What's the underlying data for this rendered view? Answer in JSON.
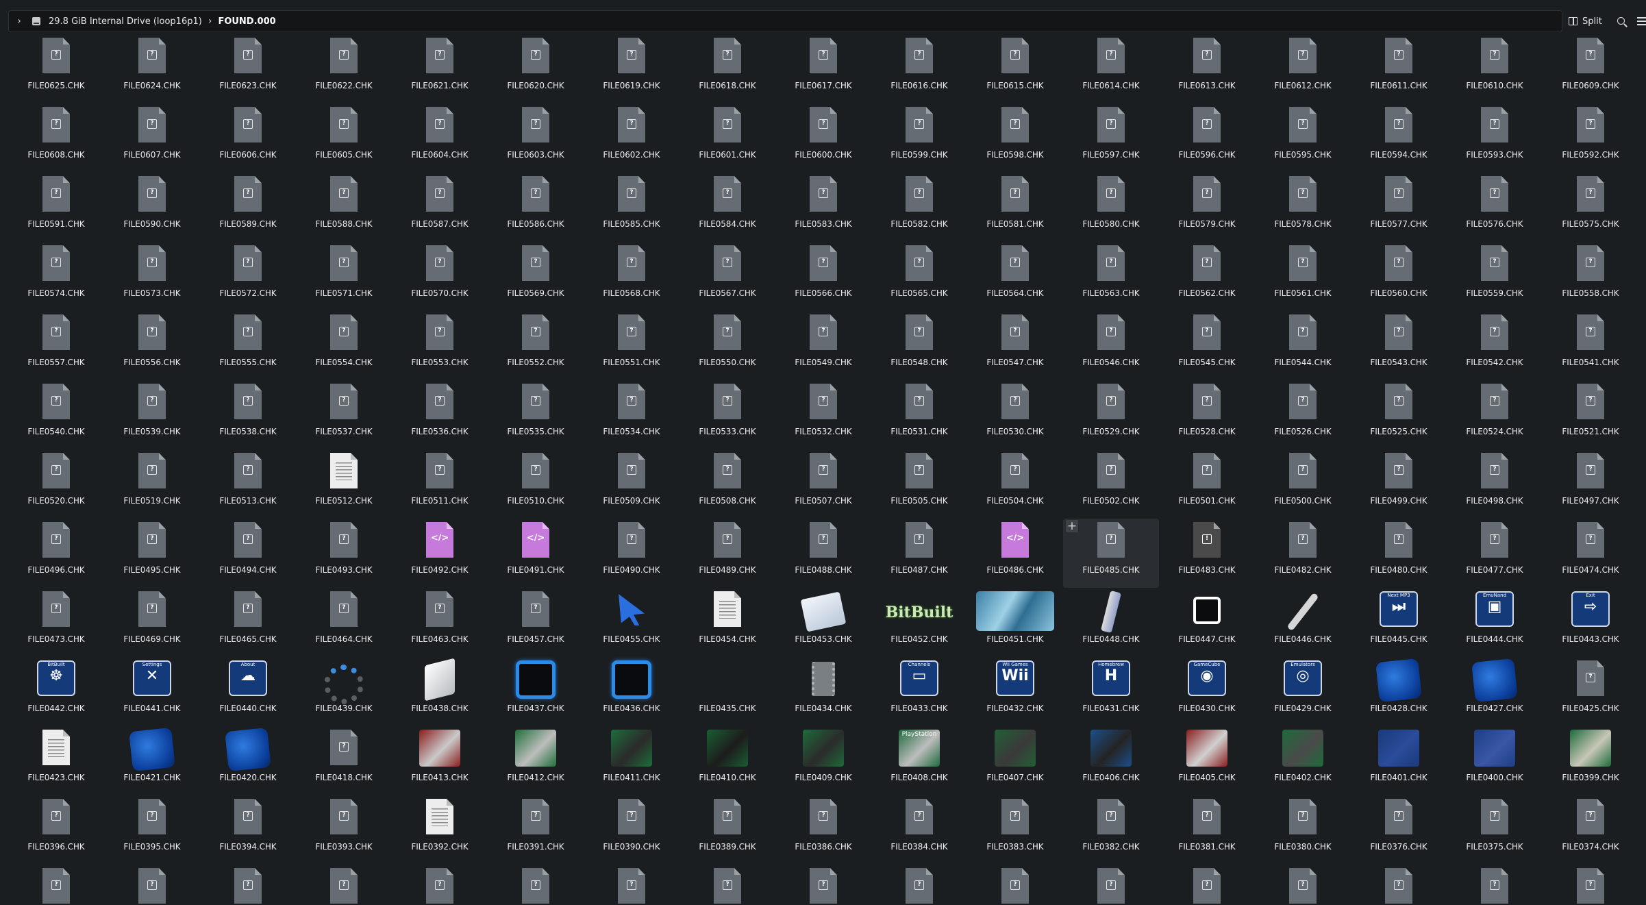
{
  "breadcrumb": {
    "drive": "29.8 GiB Internal Drive (loop16p1)",
    "folder": "FOUND.000"
  },
  "toolbar": {
    "split_label": "Split"
  },
  "files": [
    {
      "name": "FILE0625.CHK",
      "icon": "unknown"
    },
    {
      "name": "FILE0624.CHK",
      "icon": "unknown"
    },
    {
      "name": "FILE0623.CHK",
      "icon": "unknown"
    },
    {
      "name": "FILE0622.CHK",
      "icon": "unknown"
    },
    {
      "name": "FILE0621.CHK",
      "icon": "unknown"
    },
    {
      "name": "FILE0620.CHK",
      "icon": "unknown"
    },
    {
      "name": "FILE0619.CHK",
      "icon": "unknown"
    },
    {
      "name": "FILE0618.CHK",
      "icon": "unknown"
    },
    {
      "name": "FILE0617.CHK",
      "icon": "unknown"
    },
    {
      "name": "FILE0616.CHK",
      "icon": "unknown"
    },
    {
      "name": "FILE0615.CHK",
      "icon": "unknown"
    },
    {
      "name": "FILE0614.CHK",
      "icon": "unknown"
    },
    {
      "name": "FILE0613.CHK",
      "icon": "unknown"
    },
    {
      "name": "FILE0612.CHK",
      "icon": "unknown"
    },
    {
      "name": "FILE0611.CHK",
      "icon": "unknown"
    },
    {
      "name": "FILE0610.CHK",
      "icon": "unknown"
    },
    {
      "name": "FILE0609.CHK",
      "icon": "unknown"
    },
    {
      "name": "FILE0608.CHK",
      "icon": "unknown"
    },
    {
      "name": "FILE0607.CHK",
      "icon": "unknown"
    },
    {
      "name": "FILE0606.CHK",
      "icon": "unknown"
    },
    {
      "name": "FILE0605.CHK",
      "icon": "unknown"
    },
    {
      "name": "FILE0604.CHK",
      "icon": "unknown"
    },
    {
      "name": "FILE0603.CHK",
      "icon": "unknown"
    },
    {
      "name": "FILE0602.CHK",
      "icon": "unknown"
    },
    {
      "name": "FILE0601.CHK",
      "icon": "unknown"
    },
    {
      "name": "FILE0600.CHK",
      "icon": "unknown"
    },
    {
      "name": "FILE0599.CHK",
      "icon": "unknown"
    },
    {
      "name": "FILE0598.CHK",
      "icon": "unknown"
    },
    {
      "name": "FILE0597.CHK",
      "icon": "unknown"
    },
    {
      "name": "FILE0596.CHK",
      "icon": "unknown"
    },
    {
      "name": "FILE0595.CHK",
      "icon": "unknown"
    },
    {
      "name": "FILE0594.CHK",
      "icon": "unknown"
    },
    {
      "name": "FILE0593.CHK",
      "icon": "unknown"
    },
    {
      "name": "FILE0592.CHK",
      "icon": "unknown"
    },
    {
      "name": "FILE0591.CHK",
      "icon": "unknown"
    },
    {
      "name": "FILE0590.CHK",
      "icon": "unknown"
    },
    {
      "name": "FILE0589.CHK",
      "icon": "unknown"
    },
    {
      "name": "FILE0588.CHK",
      "icon": "unknown"
    },
    {
      "name": "FILE0587.CHK",
      "icon": "unknown"
    },
    {
      "name": "FILE0586.CHK",
      "icon": "unknown"
    },
    {
      "name": "FILE0585.CHK",
      "icon": "unknown"
    },
    {
      "name": "FILE0584.CHK",
      "icon": "unknown"
    },
    {
      "name": "FILE0583.CHK",
      "icon": "unknown"
    },
    {
      "name": "FILE0582.CHK",
      "icon": "unknown"
    },
    {
      "name": "FILE0581.CHK",
      "icon": "unknown"
    },
    {
      "name": "FILE0580.CHK",
      "icon": "unknown"
    },
    {
      "name": "FILE0579.CHK",
      "icon": "unknown"
    },
    {
      "name": "FILE0578.CHK",
      "icon": "unknown"
    },
    {
      "name": "FILE0577.CHK",
      "icon": "unknown"
    },
    {
      "name": "FILE0576.CHK",
      "icon": "unknown"
    },
    {
      "name": "FILE0575.CHK",
      "icon": "unknown"
    },
    {
      "name": "FILE0574.CHK",
      "icon": "unknown"
    },
    {
      "name": "FILE0573.CHK",
      "icon": "unknown"
    },
    {
      "name": "FILE0572.CHK",
      "icon": "unknown"
    },
    {
      "name": "FILE0571.CHK",
      "icon": "unknown"
    },
    {
      "name": "FILE0570.CHK",
      "icon": "unknown"
    },
    {
      "name": "FILE0569.CHK",
      "icon": "unknown"
    },
    {
      "name": "FILE0568.CHK",
      "icon": "unknown"
    },
    {
      "name": "FILE0567.CHK",
      "icon": "unknown"
    },
    {
      "name": "FILE0566.CHK",
      "icon": "unknown"
    },
    {
      "name": "FILE0565.CHK",
      "icon": "unknown"
    },
    {
      "name": "FILE0564.CHK",
      "icon": "unknown"
    },
    {
      "name": "FILE0563.CHK",
      "icon": "unknown"
    },
    {
      "name": "FILE0562.CHK",
      "icon": "unknown"
    },
    {
      "name": "FILE0561.CHK",
      "icon": "unknown"
    },
    {
      "name": "FILE0560.CHK",
      "icon": "unknown"
    },
    {
      "name": "FILE0559.CHK",
      "icon": "unknown"
    },
    {
      "name": "FILE0558.CHK",
      "icon": "unknown"
    },
    {
      "name": "FILE0557.CHK",
      "icon": "unknown"
    },
    {
      "name": "FILE0556.CHK",
      "icon": "unknown"
    },
    {
      "name": "FILE0555.CHK",
      "icon": "unknown"
    },
    {
      "name": "FILE0554.CHK",
      "icon": "unknown"
    },
    {
      "name": "FILE0553.CHK",
      "icon": "unknown"
    },
    {
      "name": "FILE0552.CHK",
      "icon": "unknown"
    },
    {
      "name": "FILE0551.CHK",
      "icon": "unknown"
    },
    {
      "name": "FILE0550.CHK",
      "icon": "unknown"
    },
    {
      "name": "FILE0549.CHK",
      "icon": "unknown"
    },
    {
      "name": "FILE0548.CHK",
      "icon": "unknown"
    },
    {
      "name": "FILE0547.CHK",
      "icon": "unknown"
    },
    {
      "name": "FILE0546.CHK",
      "icon": "unknown"
    },
    {
      "name": "FILE0545.CHK",
      "icon": "unknown"
    },
    {
      "name": "FILE0544.CHK",
      "icon": "unknown"
    },
    {
      "name": "FILE0543.CHK",
      "icon": "unknown"
    },
    {
      "name": "FILE0542.CHK",
      "icon": "unknown"
    },
    {
      "name": "FILE0541.CHK",
      "icon": "unknown"
    },
    {
      "name": "FILE0540.CHK",
      "icon": "unknown"
    },
    {
      "name": "FILE0539.CHK",
      "icon": "unknown"
    },
    {
      "name": "FILE0538.CHK",
      "icon": "unknown"
    },
    {
      "name": "FILE0537.CHK",
      "icon": "unknown"
    },
    {
      "name": "FILE0536.CHK",
      "icon": "unknown"
    },
    {
      "name": "FILE0535.CHK",
      "icon": "unknown"
    },
    {
      "name": "FILE0534.CHK",
      "icon": "unknown"
    },
    {
      "name": "FILE0533.CHK",
      "icon": "unknown"
    },
    {
      "name": "FILE0532.CHK",
      "icon": "unknown"
    },
    {
      "name": "FILE0531.CHK",
      "icon": "unknown"
    },
    {
      "name": "FILE0530.CHK",
      "icon": "unknown"
    },
    {
      "name": "FILE0529.CHK",
      "icon": "unknown"
    },
    {
      "name": "FILE0528.CHK",
      "icon": "unknown"
    },
    {
      "name": "FILE0526.CHK",
      "icon": "unknown"
    },
    {
      "name": "FILE0525.CHK",
      "icon": "unknown"
    },
    {
      "name": "FILE0524.CHK",
      "icon": "unknown"
    },
    {
      "name": "FILE0521.CHK",
      "icon": "unknown"
    },
    {
      "name": "FILE0520.CHK",
      "icon": "unknown"
    },
    {
      "name": "FILE0519.CHK",
      "icon": "unknown"
    },
    {
      "name": "FILE0513.CHK",
      "icon": "unknown"
    },
    {
      "name": "FILE0512.CHK",
      "icon": "text"
    },
    {
      "name": "FILE0511.CHK",
      "icon": "unknown"
    },
    {
      "name": "FILE0510.CHK",
      "icon": "unknown"
    },
    {
      "name": "FILE0509.CHK",
      "icon": "unknown"
    },
    {
      "name": "FILE0508.CHK",
      "icon": "unknown"
    },
    {
      "name": "FILE0507.CHK",
      "icon": "unknown"
    },
    {
      "name": "FILE0505.CHK",
      "icon": "unknown"
    },
    {
      "name": "FILE0504.CHK",
      "icon": "unknown"
    },
    {
      "name": "FILE0502.CHK",
      "icon": "unknown"
    },
    {
      "name": "FILE0501.CHK",
      "icon": "unknown"
    },
    {
      "name": "FILE0500.CHK",
      "icon": "unknown"
    },
    {
      "name": "FILE0499.CHK",
      "icon": "unknown"
    },
    {
      "name": "FILE0498.CHK",
      "icon": "unknown"
    },
    {
      "name": "FILE0497.CHK",
      "icon": "unknown"
    },
    {
      "name": "FILE0496.CHK",
      "icon": "unknown"
    },
    {
      "name": "FILE0495.CHK",
      "icon": "unknown"
    },
    {
      "name": "FILE0494.CHK",
      "icon": "unknown"
    },
    {
      "name": "FILE0493.CHK",
      "icon": "unknown"
    },
    {
      "name": "FILE0492.CHK",
      "icon": "code"
    },
    {
      "name": "FILE0491.CHK",
      "icon": "code"
    },
    {
      "name": "FILE0490.CHK",
      "icon": "unknown"
    },
    {
      "name": "FILE0489.CHK",
      "icon": "unknown"
    },
    {
      "name": "FILE0488.CHK",
      "icon": "unknown"
    },
    {
      "name": "FILE0487.CHK",
      "icon": "unknown"
    },
    {
      "name": "FILE0486.CHK",
      "icon": "code"
    },
    {
      "name": "FILE0485.CHK",
      "icon": "unknown",
      "hover": true
    },
    {
      "name": "FILE0483.CHK",
      "icon": "warn"
    },
    {
      "name": "FILE0482.CHK",
      "icon": "unknown"
    },
    {
      "name": "FILE0480.CHK",
      "icon": "unknown"
    },
    {
      "name": "FILE0477.CHK",
      "icon": "unknown"
    },
    {
      "name": "FILE0474.CHK",
      "icon": "unknown"
    },
    {
      "name": "FILE0473.CHK",
      "icon": "unknown"
    },
    {
      "name": "FILE0469.CHK",
      "icon": "unknown"
    },
    {
      "name": "FILE0465.CHK",
      "icon": "unknown"
    },
    {
      "name": "FILE0464.CHK",
      "icon": "unknown"
    },
    {
      "name": "FILE0463.CHK",
      "icon": "unknown"
    },
    {
      "name": "FILE0457.CHK",
      "icon": "unknown"
    },
    {
      "name": "FILE0455.CHK",
      "icon": "cursor"
    },
    {
      "name": "FILE0454.CHK",
      "icon": "text"
    },
    {
      "name": "FILE0453.CHK",
      "icon": "discs"
    },
    {
      "name": "FILE0452.CHK",
      "icon": "bitbuilt",
      "text": "BitBuilt"
    },
    {
      "name": "FILE0451.CHK",
      "icon": "banner"
    },
    {
      "name": "FILE0448.CHK",
      "icon": "wiimote"
    },
    {
      "name": "FILE0447.CHK",
      "icon": "chip"
    },
    {
      "name": "FILE0446.CHK",
      "icon": "wrench"
    },
    {
      "name": "FILE0445.CHK",
      "icon": "tile",
      "text": "⏭",
      "cap": "Next MP3"
    },
    {
      "name": "FILE0444.CHK",
      "icon": "tile",
      "text": "▣",
      "cap": "EmuNand"
    },
    {
      "name": "FILE0443.CHK",
      "icon": "tile",
      "text": "⇨",
      "cap": "Exit"
    },
    {
      "name": "FILE0442.CHK",
      "icon": "tile",
      "text": "☸",
      "cap": "BitBuilt"
    },
    {
      "name": "FILE0441.CHK",
      "icon": "tile",
      "text": "✕",
      "cap": "Settings"
    },
    {
      "name": "FILE0440.CHK",
      "icon": "tile",
      "text": "☁",
      "cap": "About"
    },
    {
      "name": "FILE0439.CHK",
      "icon": "spinner"
    },
    {
      "name": "FILE0438.CHK",
      "icon": "wii"
    },
    {
      "name": "FILE0437.CHK",
      "icon": "frame"
    },
    {
      "name": "FILE0436.CHK",
      "icon": "frame"
    },
    {
      "name": "FILE0435.CHK",
      "icon": "none"
    },
    {
      "name": "FILE0434.CHK",
      "icon": "chipgray"
    },
    {
      "name": "FILE0433.CHK",
      "icon": "tile",
      "text": "▭",
      "cap": "Channels"
    },
    {
      "name": "FILE0432.CHK",
      "icon": "tile",
      "text": "Wii",
      "cap": "Wii Games"
    },
    {
      "name": "FILE0431.CHK",
      "icon": "tile",
      "text": "H",
      "cap": "Homebrew"
    },
    {
      "name": "FILE0430.CHK",
      "icon": "tile",
      "text": "◉",
      "cap": "GameCube"
    },
    {
      "name": "FILE0429.CHK",
      "icon": "tile",
      "text": "◎",
      "cap": "Emulators"
    },
    {
      "name": "FILE0428.CHK",
      "icon": "blob"
    },
    {
      "name": "FILE0427.CHK",
      "icon": "blob"
    },
    {
      "name": "FILE0425.CHK",
      "icon": "unknown"
    },
    {
      "name": "FILE0423.CHK",
      "icon": "text"
    },
    {
      "name": "FILE0421.CHK",
      "icon": "blob"
    },
    {
      "name": "FILE0420.CHK",
      "icon": "blob"
    },
    {
      "name": "FILE0418.CHK",
      "icon": "unknown"
    },
    {
      "name": "FILE0413.CHK",
      "icon": "console",
      "c1": "#c9c9c9",
      "c2": "#8b1d1d"
    },
    {
      "name": "FILE0412.CHK",
      "icon": "console",
      "c1": "#bdbdbd",
      "c2": "#1f6f3a"
    },
    {
      "name": "FILE0411.CHK",
      "icon": "console",
      "c1": "#2a2a2a",
      "c2": "#1d6e3a"
    },
    {
      "name": "FILE0410.CHK",
      "icon": "console",
      "c1": "#1c1c1c",
      "c2": "#1a5e33"
    },
    {
      "name": "FILE0409.CHK",
      "icon": "console",
      "c1": "#2b2b2b",
      "c2": "#1d6b3a"
    },
    {
      "name": "FILE0408.CHK",
      "icon": "console",
      "c1": "#bdbdbd",
      "c2": "#1e6a3e",
      "label": "PlayStation"
    },
    {
      "name": "FILE0407.CHK",
      "icon": "console",
      "c1": "#3a3a3a",
      "c2": "#225f35"
    },
    {
      "name": "FILE0406.CHK",
      "icon": "console",
      "c1": "#242424",
      "c2": "#1c4f8a"
    },
    {
      "name": "FILE0405.CHK",
      "icon": "console",
      "c1": "#d0d0d0",
      "c2": "#8a1e1e"
    },
    {
      "name": "FILE0402.CHK",
      "icon": "console",
      "c1": "#4a4a4a",
      "c2": "#1d6b3a"
    },
    {
      "name": "FILE0401.CHK",
      "icon": "console",
      "c1": "#2a4c9a",
      "c2": "#1a3a7a"
    },
    {
      "name": "FILE0400.CHK",
      "icon": "console",
      "c1": "#3a56a6",
      "c2": "#1c3f85"
    },
    {
      "name": "FILE0399.CHK",
      "icon": "console",
      "c1": "#c7c7b8",
      "c2": "#1d6b3a"
    },
    {
      "name": "FILE0396.CHK",
      "icon": "unknown"
    },
    {
      "name": "FILE0395.CHK",
      "icon": "unknown"
    },
    {
      "name": "FILE0394.CHK",
      "icon": "unknown"
    },
    {
      "name": "FILE0393.CHK",
      "icon": "unknown"
    },
    {
      "name": "FILE0392.CHK",
      "icon": "text"
    },
    {
      "name": "FILE0391.CHK",
      "icon": "unknown"
    },
    {
      "name": "FILE0390.CHK",
      "icon": "unknown"
    },
    {
      "name": "FILE0389.CHK",
      "icon": "unknown"
    },
    {
      "name": "FILE0386.CHK",
      "icon": "unknown"
    },
    {
      "name": "FILE0384.CHK",
      "icon": "unknown"
    },
    {
      "name": "FILE0383.CHK",
      "icon": "unknown"
    },
    {
      "name": "FILE0382.CHK",
      "icon": "unknown"
    },
    {
      "name": "FILE0381.CHK",
      "icon": "unknown"
    },
    {
      "name": "FILE0380.CHK",
      "icon": "unknown"
    },
    {
      "name": "FILE0376.CHK",
      "icon": "unknown"
    },
    {
      "name": "FILE0375.CHK",
      "icon": "unknown"
    },
    {
      "name": "FILE0374.CHK",
      "icon": "unknown"
    },
    {
      "name": "",
      "icon": "unknown"
    },
    {
      "name": "",
      "icon": "unknown"
    },
    {
      "name": "",
      "icon": "unknown"
    },
    {
      "name": "",
      "icon": "unknown"
    },
    {
      "name": "",
      "icon": "unknown"
    },
    {
      "name": "",
      "icon": "unknown"
    },
    {
      "name": "",
      "icon": "unknown"
    },
    {
      "name": "",
      "icon": "unknown"
    },
    {
      "name": "",
      "icon": "unknown"
    },
    {
      "name": "",
      "icon": "unknown"
    },
    {
      "name": "",
      "icon": "unknown"
    },
    {
      "name": "",
      "icon": "unknown"
    },
    {
      "name": "",
      "icon": "unknown"
    },
    {
      "name": "",
      "icon": "unknown"
    },
    {
      "name": "",
      "icon": "unknown"
    },
    {
      "name": "",
      "icon": "unknown"
    },
    {
      "name": "",
      "icon": "unknown"
    }
  ]
}
